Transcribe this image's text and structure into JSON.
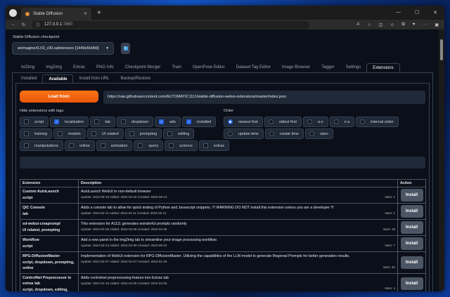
{
  "browser": {
    "tab_title": "Stable Diffusion",
    "url_host": "127.0.0.1",
    "url_port": ":7860"
  },
  "checkpoint": {
    "label": "Stable Diffusion checkpoint",
    "value": "animagineXLV3_v30.safetensors [1449e5b0b9]"
  },
  "tabs": [
    "txt2img",
    "img2img",
    "Extras",
    "PNG Info",
    "Checkpoint Merger",
    "Train",
    "OpenPose Editor",
    "Dataset Tag Editor",
    "Image Browser",
    "Tagger",
    "Settings",
    "Extensions"
  ],
  "active_tab": "Extensions",
  "subtabs": [
    "Installed",
    "Available",
    "Install from URL",
    "Backup/Restore"
  ],
  "load_button": "Load from:",
  "load_url": "https://raw.githubusercontent.com/AUTOMATIC1111/stable-diffusion-webui-extensions/master/index.json",
  "hide_label": "Hide extensions with tags",
  "hide_tags": [
    {
      "label": "script",
      "checked": false
    },
    {
      "label": "localization",
      "checked": true
    },
    {
      "label": "tab",
      "checked": false
    },
    {
      "label": "dropdown",
      "checked": false
    },
    {
      "label": "ads",
      "checked": true
    },
    {
      "label": "installed",
      "checked": true
    },
    {
      "label": "training",
      "checked": false
    },
    {
      "label": "models",
      "checked": false
    },
    {
      "label": "UI related",
      "checked": false
    },
    {
      "label": "prompting",
      "checked": false
    },
    {
      "label": "editing",
      "checked": false
    },
    {
      "label": "manipulations",
      "checked": false
    },
    {
      "label": "online",
      "checked": false
    },
    {
      "label": "animation",
      "checked": false
    },
    {
      "label": "query",
      "checked": false
    },
    {
      "label": "science",
      "checked": false
    },
    {
      "label": "extras",
      "checked": false
    }
  ],
  "order_label": "Order",
  "order_options": [
    {
      "label": "newest first",
      "selected": true
    },
    {
      "label": "oldest first",
      "selected": false
    },
    {
      "label": "a-z",
      "selected": false
    },
    {
      "label": "z-a",
      "selected": false
    },
    {
      "label": "internal order",
      "selected": false
    },
    {
      "label": "update time",
      "selected": false
    },
    {
      "label": "create time",
      "selected": false
    },
    {
      "label": "stars",
      "selected": false
    }
  ],
  "table": {
    "headers": [
      "Extension",
      "Description",
      "Action"
    ],
    "rows": [
      {
        "name": "Custom AutoLaunch",
        "tags": "script",
        "desc": "AutoLaunch WebUI in non-default browser",
        "meta": "Update: 2023-09-15 Added: 2024-02-18 Created: 2023-09-13",
        "stars": "stars: 1",
        "action": "Install"
      },
      {
        "name": "QIC Console",
        "tags": "tab",
        "desc": "Adds a console tab to allow for quick testing of Python and Javascript snippets. !!! WARNING DO NOT install this extension unless you are a developer !!!",
        "meta": "Update: 2024-02-11 Added: 2024-02-11 Created: 2024-02-11",
        "stars": "stars: 1",
        "action": "Install"
      },
      {
        "name": "sd-webui-creaprompt",
        "tags": "UI related, prompting",
        "desc": "This extension for A1111 generates wonderful prompts randomly",
        "meta": "Update: 2024-02-25 Added: 2024-02-09 Created: 2024-02-08",
        "stars": "stars: 18",
        "action": "Install"
      },
      {
        "name": "Workflow",
        "tags": "script",
        "desc": "Add a new panel in the img2img tab to streamline your image processing workflow.",
        "meta": "Update: 2024-02-24 Added: 2024-02-09 Created: 2023-08-24",
        "stars": "stars: 7",
        "action": "Install"
      },
      {
        "name": "RPG-DiffusionMaster",
        "tags": "script, dropdown, prompting, online",
        "desc": "Implementation of WebUI extension for RPG-DiffusionMaster. Utilizing the capabilities of the LLM model to generate Regional Prompts for better generation results.",
        "meta": "Update: 2024-02-07 Added: 2024-02-07 Created: 2024-01-26",
        "stars": "stars: 42",
        "action": "Install"
      },
      {
        "name": "ControlNet Preprocessor in extras tab",
        "tags": "script, dropdown, editing,",
        "desc": "Adds controlnet preprocessing feature into Extras tab",
        "meta": "Update: 2024-02-15 Added: 2024-02-06 Created: 2024-02-03",
        "stars": "stars: 4",
        "action": "Install"
      }
    ]
  }
}
